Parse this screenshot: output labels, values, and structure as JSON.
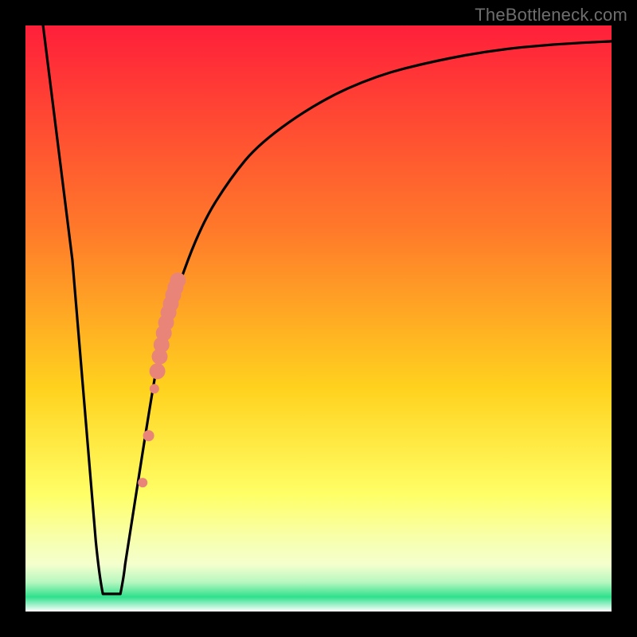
{
  "watermark": "TheBottleneck.com",
  "colors": {
    "frame": "#000000",
    "curve": "#000000",
    "dot_fill": "#e98479",
    "dot_stroke": "#c46a60",
    "grad_top": "#ff1f3a",
    "grad_mid1": "#ff7a2a",
    "grad_mid2": "#ffd21e",
    "grad_mid3": "#ffff66",
    "grad_mid4": "#f7ffb0",
    "grad_green1": "#b7f7c0",
    "grad_green2": "#2fe08c",
    "grad_white": "#ffffff"
  },
  "chart_data": {
    "type": "line",
    "title": "",
    "xlabel": "",
    "ylabel": "",
    "xlim": [
      0,
      100
    ],
    "ylim": [
      0,
      100
    ],
    "curve": {
      "name": "bottleneck-curve",
      "x": [
        3,
        8,
        12,
        13.5,
        16,
        17,
        22,
        23.5,
        25.5,
        30,
        35,
        40,
        50,
        60,
        70,
        80,
        90,
        100
      ],
      "y": [
        100,
        60,
        12,
        3,
        3,
        8,
        40,
        47,
        54,
        66,
        74,
        80,
        87,
        91.5,
        94,
        95.8,
        96.8,
        97.3
      ]
    },
    "flat_bottom": {
      "x_start": 13.2,
      "x_end": 16.2,
      "y": 3
    },
    "dots": [
      {
        "x": 20.0,
        "y": 22.0,
        "r": 6
      },
      {
        "x": 21.0,
        "y": 30.0,
        "r": 7
      },
      {
        "x": 22.0,
        "y": 38.0,
        "r": 6
      },
      {
        "x": 22.5,
        "y": 41.0,
        "r": 10
      },
      {
        "x": 22.9,
        "y": 43.5,
        "r": 10
      },
      {
        "x": 23.2,
        "y": 45.5,
        "r": 10
      },
      {
        "x": 23.6,
        "y": 47.5,
        "r": 10
      },
      {
        "x": 24.0,
        "y": 49.3,
        "r": 10
      },
      {
        "x": 24.4,
        "y": 51.0,
        "r": 10
      },
      {
        "x": 24.8,
        "y": 52.5,
        "r": 10
      },
      {
        "x": 25.2,
        "y": 54.0,
        "r": 10
      },
      {
        "x": 25.6,
        "y": 55.3,
        "r": 10
      },
      {
        "x": 26.0,
        "y": 56.5,
        "r": 10
      }
    ],
    "gradient_bands": [
      {
        "y_from": 100,
        "y_to": 18,
        "type": "smooth"
      },
      {
        "y_from": 18,
        "y_to": 6,
        "type": "pale-yellow"
      },
      {
        "y_from": 6,
        "y_to": 0,
        "type": "green-white"
      }
    ]
  }
}
